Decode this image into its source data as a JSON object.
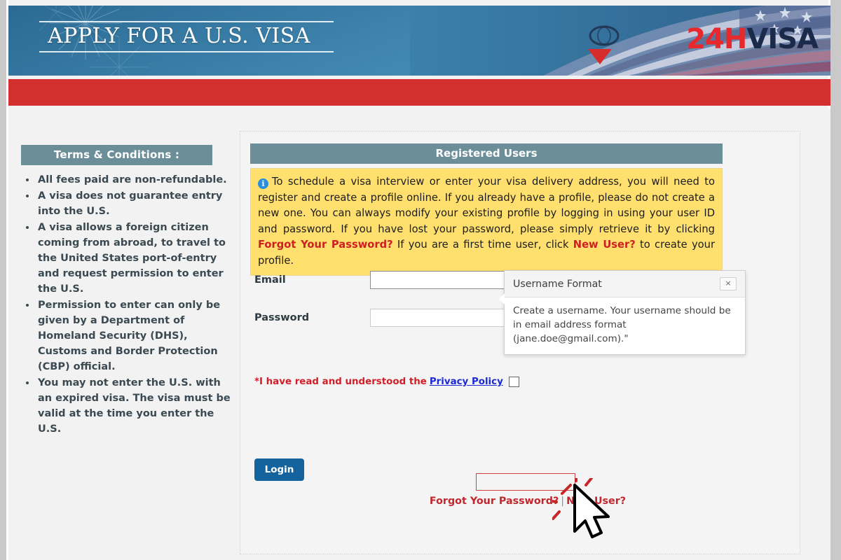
{
  "banner": {
    "title": "APPLY FOR A U.S. VISA",
    "logo_prefix": "24H",
    "logo_suffix": "VISA"
  },
  "terms": {
    "heading": "Terms & Conditions :",
    "items": [
      "All fees paid are non-refundable.",
      "A visa does not guarantee entry into the U.S.",
      "A visa allows a foreign citizen coming from abroad, to travel to the United States port-of-entry and request permission to enter the U.S.",
      "Permission to enter can only be given by a Department of Homeland Security (DHS), Customs and Border Protection (CBP) official.",
      "You may not enter the U.S. with an expired visa. The visa must be valid at the time you enter the U.S."
    ]
  },
  "panel": {
    "heading": "Registered Users",
    "info": {
      "part1": "To schedule a visa interview or enter your visa delivery address, you will need to register and create a profile online. If you already have a profile, please do not create a new one. You can always modify your existing profile by logging in using your user ID and password. If you have lost your password, please simply retrieve it by clicking ",
      "link1": "Forgot Your Password?",
      "part2": " If you are a first time user, click ",
      "link2": "New User?",
      "part3": " to create your profile."
    },
    "form": {
      "email_label": "Email",
      "email_value": "",
      "email_placeholder": "",
      "password_label": "Password",
      "password_value": "",
      "password_placeholder": ""
    },
    "privacy": {
      "text": "*I have read and understood the",
      "link": "Privacy Policy",
      "checked": false
    },
    "login_label": "Login",
    "links": {
      "forgot": "Forgot Your Password?",
      "separator": "|",
      "new_user": "New User?"
    }
  },
  "tooltip": {
    "title": "Username Format",
    "close_label": "×",
    "body": "Create a username. Your username should be in email address format (jane.doe@gmail.com).\""
  },
  "colors": {
    "red_bar": "#d32f2f",
    "teal_header": "#6c8e98",
    "info_yellow": "#ffdf6e",
    "login_blue": "#14639e",
    "link_red": "#c1272d",
    "highlight_red": "#d2403f",
    "logo_red": "#e8282b",
    "logo_navy": "#1b2a4a"
  }
}
